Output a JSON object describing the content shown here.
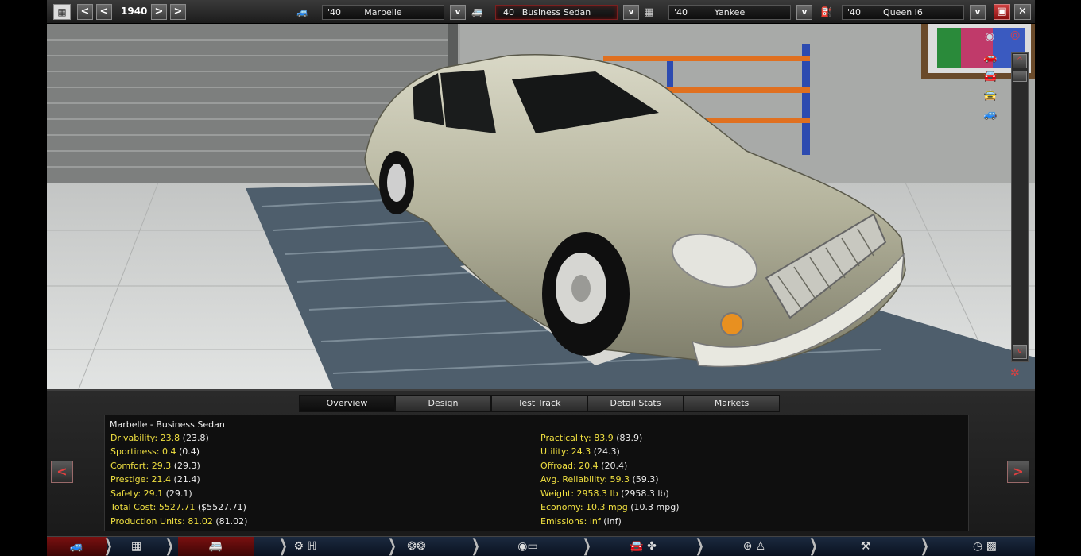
{
  "topbar": {
    "year": "1940",
    "nav": {
      "prev_far": "<",
      "prev": "<",
      "next": ">",
      "next_far": ">"
    },
    "model": {
      "year": "'40",
      "name": "Marbelle",
      "dropdown": "v"
    },
    "trim": {
      "year": "'40",
      "name": "Business Sedan",
      "dropdown": "v"
    },
    "chassis": {
      "year": "'40",
      "name": "Yankee",
      "dropdown": "v"
    },
    "engine": {
      "year": "'40",
      "name": "Queen I6",
      "dropdown": "v"
    },
    "close": "✕"
  },
  "tabs": [
    {
      "label": "Overview"
    },
    {
      "label": "Design"
    },
    {
      "label": "Test Track"
    },
    {
      "label": "Detail Stats"
    },
    {
      "label": "Markets"
    }
  ],
  "overview": {
    "title": "Marbelle - Business Sedan",
    "left": [
      {
        "label": "Drivability: 23.8",
        "paren": "(23.8)"
      },
      {
        "label": "Sportiness: 0.4",
        "paren": "(0.4)"
      },
      {
        "label": "Comfort: 29.3",
        "paren": "(29.3)"
      },
      {
        "label": "Prestige: 21.4",
        "paren": "(21.4)"
      },
      {
        "label": "Safety: 29.1",
        "paren": "(29.1)"
      },
      {
        "label": "Total Cost: 5527.71",
        "paren": "($5527.71)"
      },
      {
        "label": "Production Units: 81.02",
        "paren": "(81.02)"
      }
    ],
    "right": [
      {
        "label": "Practicality: 83.9",
        "paren": "(83.9)"
      },
      {
        "label": "Utility: 24.3",
        "paren": "(24.3)"
      },
      {
        "label": "Offroad: 20.4",
        "paren": "(20.4)"
      },
      {
        "label": "Avg. Reliability: 59.3",
        "paren": "(59.3)"
      },
      {
        "label": "Weight: 2958.3 lb",
        "paren": "(2958.3 lb)"
      },
      {
        "label": "Economy: 10.3 mpg",
        "paren": "(10.3 mpg)"
      },
      {
        "label": "Emissions: inf",
        "paren": "(inf)"
      }
    ]
  },
  "side_nav": {
    "prev": "<",
    "next": ">"
  },
  "scroll": {
    "up": "^",
    "down": "v"
  }
}
